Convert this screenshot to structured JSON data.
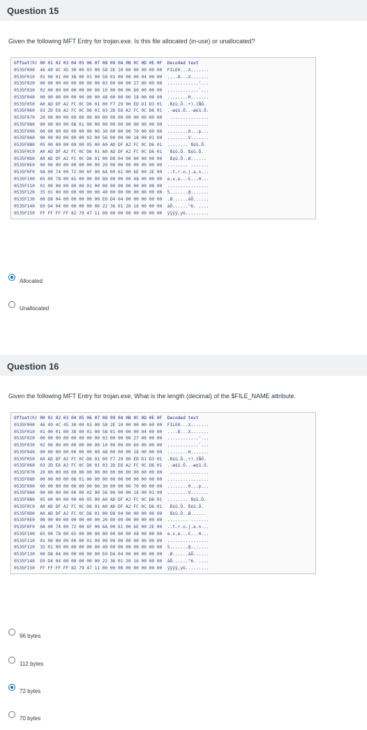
{
  "q15": {
    "title": "Question 15",
    "prompt": "Given the following MFT Entry for trojan.exe.  Is this file allocated (in-use) or unallocated?",
    "options": [
      {
        "label": "Allocated",
        "selected": true
      },
      {
        "label": "Unallocated",
        "selected": false
      }
    ]
  },
  "q16": {
    "title": "Question 16",
    "prompt": "Given the following MFT Entry for trojan.exe, What is the length (decimal) of the $FILE_NAME attribute.",
    "options": [
      {
        "label": "96 bytes",
        "selected": false
      },
      {
        "label": "112 bytes",
        "selected": false
      },
      {
        "label": "72 bytes",
        "selected": true
      },
      {
        "label": "70 bytes",
        "selected": false
      }
    ]
  },
  "hexdump": {
    "header": "Offset(h) 00 01 02 03 04 05 06 07 08 09 0A 0B 0C 0D 0E 0F  Decoded text",
    "rows": [
      "0535F000  46 49 4C 45 30 00 03 00 58 2E 10 00 00 00 00 00  FILE0...X.......",
      "0535F010  01 00 01 00 38 00 01 00 58 01 00 00 00 04 00 00  ....8...X.......",
      "0535F020  00 00 00 00 00 00 00 00 03 00 00 00 27 00 00 00  ............'...",
      "0535F030  02 00 00 00 00 00 00 00 10 00 00 00 60 00 00 00  ............`...",
      "0535F040  00 00 00 00 00 00 00 00 48 00 00 00 18 00 00 00  ........H.......",
      "0535F050  A0 AD DF A2 FC 0C D6 01 00 F7 29 90 ED D1 D3 01  .­ß¢ü.Ö..÷).íÑÓ.",
      "0535F060  03 2D E6 A2 FC 0C D6 01 03 2D E6 A2 FC 0C D6 01  .-æ¢ü.Ö..-æ¢ü.Ö.",
      "0535F070  20 00 00 00 00 00 00 00 00 00 00 00 00 00 00 00   ...............",
      "0535F080  00 00 00 00 08 01 00 00 00 00 00 00 00 00 00 00  ................",
      "0535F090  00 00 00 00 00 00 00 00 30 00 00 00 70 00 00 00  ........0...p...",
      "0535F0A0  00 00 00 00 00 00 02 00 56 00 00 00 18 00 01 00  ........V.......",
      "0535F0B0  05 00 00 00 00 00 05 00 A0 AD DF A2 FC 0C D6 01  ........ ­ß¢ü.Ö.",
      "0535F0C0  A0 AD DF A2 FC 0C D6 01 A0 AD DF A2 FC 0C D6 01   ­ß¢ü.Ö. ­ß¢ü.Ö.",
      "0535F0D0  A0 AD DF A2 FC 0C D6 01 00 D8 04 00 00 00 00 00   ­ß¢ü.Ö..Ø......",
      "0535F0E0  00 00 00 00 00 00 00 00 20 00 00 00 00 00 00 00  ........ .......",
      "0535F0F0  0A 00 74 00 72 00 6F 00 6A 00 61 00 6E 00 2E 00  ..t.r.o.j.a.n...",
      "0535F100  65 00 78 00 65 00 00 00 80 00 00 00 48 00 00 00  e.x.e...€...H...",
      "0535F110  01 00 00 00 00 00 01 00 00 00 00 00 00 00 00 00  ................",
      "0535F120  35 01 00 00 00 00 00 00 40 00 00 00 00 00 00 00  5.......@.......",
      "0535F130  00 D8 04 00 00 00 00 00 E0 D4 04 00 00 00 00 00  .Ø......àÔ......",
      "0535F140  E0 D4 04 00 00 00 00 00 22 36 01 20 16 00 00 00  àÔ......\"6. ....",
      "0535F150  FF FF FF FF 82 79 47 11 00 00 00 00 00 00 00 00  ÿÿÿÿ‚yG........."
    ]
  }
}
